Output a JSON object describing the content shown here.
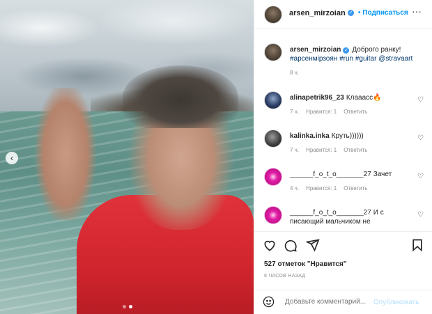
{
  "post": {
    "author": "arsen_mirzoian",
    "follow_label": "Подписаться",
    "bullet": "•",
    "more_icon": "more-horizontal-icon",
    "carousel_prev_icon": "chevron-left-icon"
  },
  "caption": {
    "username": "arsen_mirzoian",
    "text": "Доброго ранку!",
    "hashtags": "#арсенмірзоян #run #guitar @stravaart",
    "time": "8 ч."
  },
  "comments": [
    {
      "username": "alinapetrik96_23",
      "text": "Клааасс🔥",
      "time": "7 ч.",
      "likes": "Нравится: 1",
      "reply": "Ответить"
    },
    {
      "username": "kalinka.inka",
      "text": "Круть))))))",
      "time": "7 ч.",
      "likes": "Нравится: 1",
      "reply": "Ответить"
    },
    {
      "username": "______f_o_t_o_______27",
      "text": "Зачет",
      "time": "4 ч.",
      "likes": "Нравится: 1",
      "reply": "Ответить"
    },
    {
      "username": "______f_o_t_o_______27",
      "text": "И с писающий мальчиком не",
      "time": "",
      "likes": "",
      "reply": ""
    }
  ],
  "actions": {
    "like_icon": "heart-icon",
    "comment_icon": "comment-icon",
    "share_icon": "send-icon",
    "save_icon": "bookmark-icon"
  },
  "likes_text": "527 отметок \"Нравится\"",
  "post_time": "8 ЧАСОВ НАЗАД",
  "add_comment": {
    "placeholder": "Добавьте комментарий...",
    "publish_label": "Опубликовать"
  },
  "colors": {
    "link_blue": "#0095f6",
    "publish_disabled": "#b2dffc",
    "hashtag": "#00376b"
  }
}
